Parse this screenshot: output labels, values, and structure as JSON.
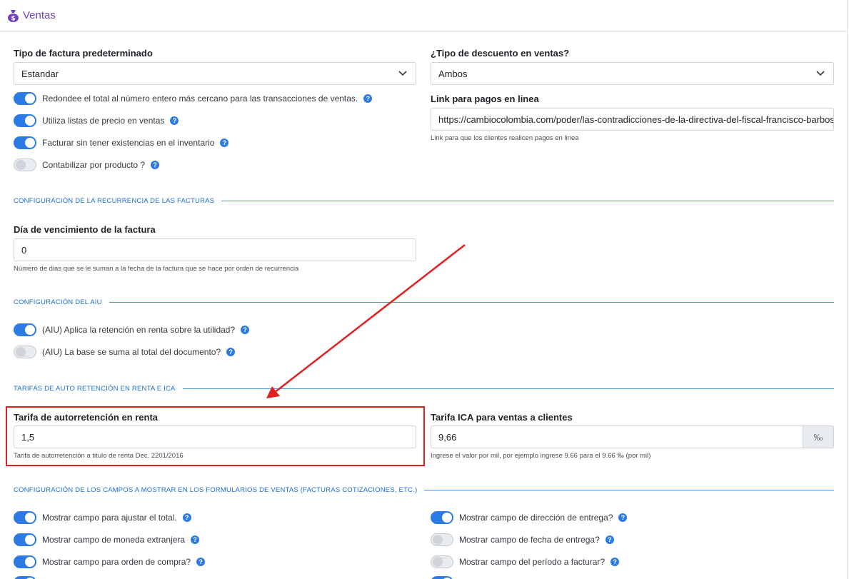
{
  "header": {
    "title": "Ventas",
    "icon": "money-bag-icon"
  },
  "invoice_type": {
    "label": "Tipo de factura predeterminado",
    "value": "Estandar"
  },
  "discount_type": {
    "label": "¿Tipo de descuento en ventas?",
    "value": "Ambos"
  },
  "payment_link": {
    "label": "Link para pagos en linea",
    "value": "https://cambiocolombia.com/poder/las-contradicciones-de-la-directiva-del-fiscal-francisco-barbosa/",
    "help": "Link para que los clientes realicen pagos en linea"
  },
  "toggles_top": [
    {
      "label": "Redondee el total al número entero más cercano para las transacciones de ventas.",
      "on": true
    },
    {
      "label": "Utiliza listas de precio en ventas",
      "on": true
    },
    {
      "label": "Facturar sin tener existencias en el inventario",
      "on": true
    },
    {
      "label": "Contabilizar por producto ?",
      "on": false
    }
  ],
  "sections": {
    "recurrence": "CONFIGURACIÓN DE LA RECURRENCIA DE LAS FACTURAS",
    "aiu": "CONFIGURACIÓN DEL AIU",
    "rates": "TARIFAS DE AUTO RETENCIÓN EN RENTA E ICA",
    "fields": "CONFIGURACIÓN DE LOS CAMPOS A MOSTRAR EN LOS FORMULARIOS DE VENTAS (FACTURAS COTIZACIONES, ETC.)"
  },
  "due_day": {
    "label": "Día de vencimiento de la factura",
    "value": "0",
    "help": "Número de dias que se le suman a la fecha de la factura que se hace por orden de recurrencia"
  },
  "aiu_toggles": [
    {
      "label": "(AIU) Aplica la retención en renta sobre la utilidad?",
      "on": true
    },
    {
      "label": "(AIU) La base se suma al total del documento?",
      "on": false
    }
  ],
  "autoretention": {
    "label": "Tarifa de autorretención en renta",
    "value": "1,5",
    "help": "Tarifa de autorretención a titulo de renta Dec. 2201/2016"
  },
  "ica": {
    "label": "Tarifa ICA para ventas a clientes",
    "value": "9,66",
    "addon": "‰",
    "help": "Ingrese el valor por mil, por ejemplo ingrese 9.66 para el 9.66 ‰ (por mil)"
  },
  "fields_left": [
    {
      "label": "Mostrar campo para ajustar el total.",
      "on": true
    },
    {
      "label": "Mostrar campo de moneda extranjera",
      "on": true
    },
    {
      "label": "Mostrar campo para orden de compra?",
      "on": true
    }
  ],
  "fields_right": [
    {
      "label": "Mostrar campo de dirección de entrega?",
      "on": true
    },
    {
      "label": "Mostrar campo de fecha de entrega?",
      "on": false
    },
    {
      "label": "Mostrar campo del período a facturar?",
      "on": false
    }
  ],
  "help_glyph": "?",
  "colors": {
    "accent": "#2c7be5",
    "header_title": "#6f42c1",
    "section": "#1a6fcf",
    "highlight": "#e02020"
  }
}
